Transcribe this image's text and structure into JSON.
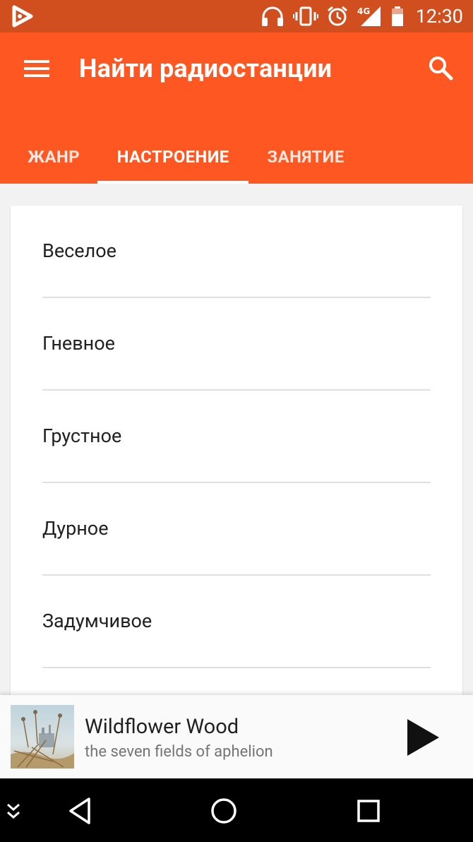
{
  "status_bar": {
    "time": "12:30",
    "network_label": "4G",
    "icons": [
      "play-logo-icon",
      "headphones-icon",
      "vibrate-icon",
      "alarm-icon",
      "signal-icon",
      "battery-icon"
    ]
  },
  "app_bar": {
    "title": "Найти радиостанции",
    "menu_icon": "hamburger-menu-icon",
    "search_icon": "search-icon"
  },
  "tabs": [
    {
      "label": "ЖАНР",
      "active": false
    },
    {
      "label": "НАСТРОЕНИЕ",
      "active": true
    },
    {
      "label": "ЗАНЯТИЕ",
      "active": false
    }
  ],
  "mood_list": [
    {
      "label": "Веселое"
    },
    {
      "label": "Гневное"
    },
    {
      "label": "Грустное"
    },
    {
      "label": "Дурное"
    },
    {
      "label": "Задумчивое"
    }
  ],
  "now_playing": {
    "title": "Wildflower Wood",
    "artist": "the seven fields of aphelion",
    "play_icon": "play-icon"
  },
  "nav_bar": {
    "icons": [
      "collapse-icon",
      "back-icon",
      "home-icon",
      "recents-icon"
    ]
  },
  "colors": {
    "status_bar": "#d14f1f",
    "app_bar": "#ff5722",
    "background": "#f2f2f2"
  }
}
